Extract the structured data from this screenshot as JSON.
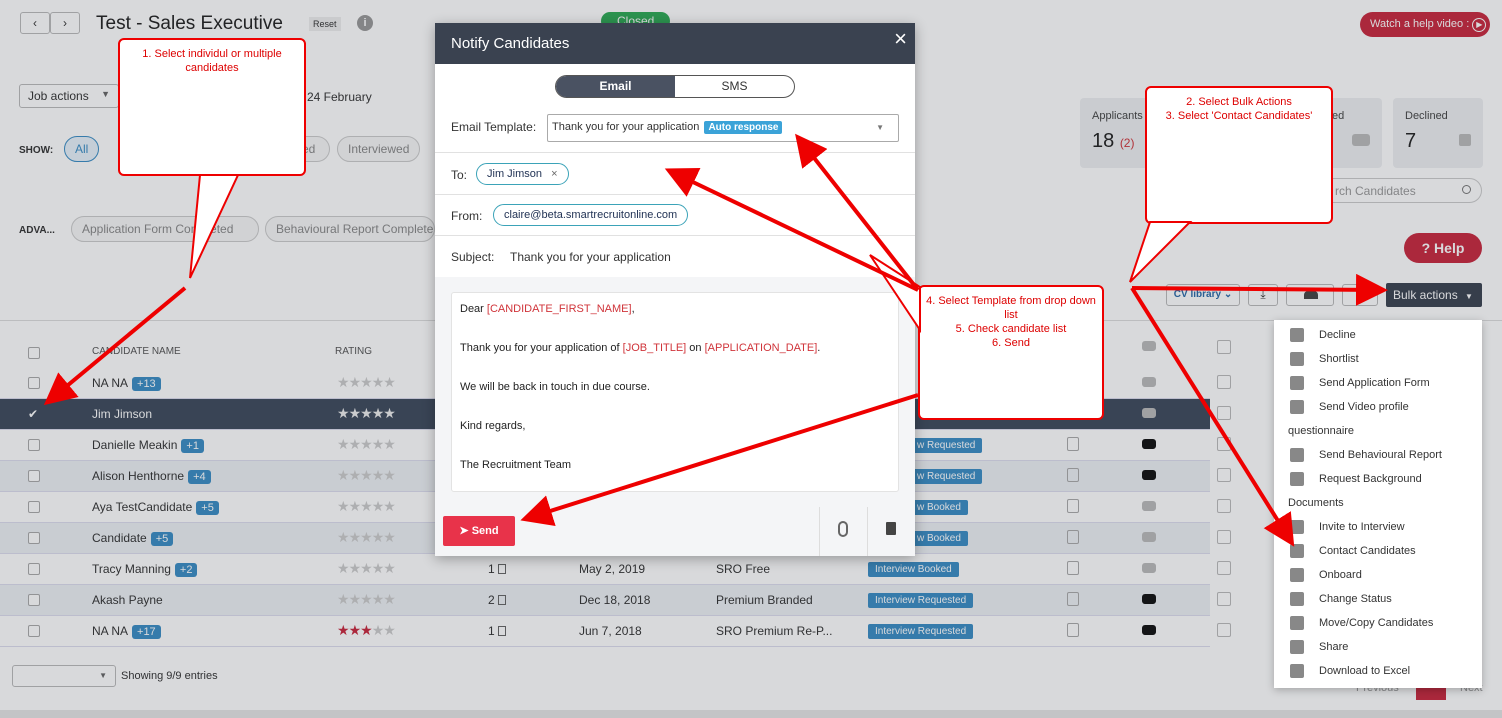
{
  "header": {
    "title": "Test - Sales Executive",
    "reset_label": "Reset",
    "status_label": "Closed",
    "help_video_label": "Watch a help video :",
    "job_actions_label": "Job actions",
    "date_text": "24 February"
  },
  "show": {
    "label": "SHOW:",
    "tabs": [
      "All",
      "ed",
      "Interviewed"
    ]
  },
  "advanced": {
    "label": "ADVA...",
    "filters": [
      "Application Form Completed",
      "Behavioural Report Complete"
    ]
  },
  "stats": [
    {
      "label": "Applicants",
      "value": "18",
      "extra": "(2)"
    },
    {
      "label": "ewed",
      "value": ""
    },
    {
      "label": "Declined",
      "value": "7"
    }
  ],
  "search": {
    "placeholder": "rch Candidates"
  },
  "help_button_label": "Help",
  "bulk_actions_label": "Bulk actions",
  "table": {
    "headers": {
      "name": "CANDIDATE NAME",
      "rating": "RATING"
    },
    "rows": [
      {
        "name": "NA NA",
        "badge": "+13",
        "stars": 0,
        "count": "",
        "date": "",
        "package": "",
        "status": "",
        "doc": false,
        "yt": "g"
      },
      {
        "name": "Jim Jimson",
        "badge": "",
        "stars": 5,
        "count": "",
        "date": "",
        "package": "",
        "status": "",
        "doc": false,
        "yt": "g",
        "selected": true
      },
      {
        "name": "Danielle Meakin",
        "badge": "+1",
        "stars": 0,
        "count": "",
        "date": "",
        "package": "",
        "status": "w Requested",
        "doc": true,
        "yt": "b"
      },
      {
        "name": "Alison Henthorne",
        "badge": "+4",
        "stars": 0,
        "count": "",
        "date": "",
        "package": "",
        "status": "w Requested",
        "doc": true,
        "yt": "b"
      },
      {
        "name": "Aya TestCandidate",
        "badge": "+5",
        "stars": 0,
        "count": "",
        "date": "",
        "package": "",
        "status": "w Booked",
        "doc": true,
        "yt": "g"
      },
      {
        "name": "Candidate",
        "badge": "+5",
        "stars": 0,
        "count": "",
        "date": "",
        "package": "",
        "status": "w Booked",
        "doc": true,
        "yt": "g"
      },
      {
        "name": "Tracy Manning",
        "badge": "+2",
        "stars": 0,
        "count": "1",
        "date": "May 2, 2019",
        "package": "SRO Free",
        "status": "Interview Booked",
        "doc": true,
        "yt": "g"
      },
      {
        "name": "Akash Payne",
        "badge": "",
        "stars": 0,
        "count": "2",
        "date": "Dec 18, 2018",
        "package": "Premium Branded",
        "status": "Interview Requested",
        "doc": true,
        "yt": "b"
      },
      {
        "name": "NA NA",
        "badge": "+17",
        "stars": 3,
        "count": "1",
        "date": "Jun 7, 2018",
        "package": "SRO Premium Re-P...",
        "status": "Interview Requested",
        "doc": true,
        "yt": "b"
      }
    ]
  },
  "footer": {
    "showing": "Showing 9/9 entries",
    "previous": "Previous",
    "next": "Next",
    "page": "1"
  },
  "modal": {
    "title": "Notify Candidates",
    "tabs": [
      "Email",
      "SMS"
    ],
    "template_label": "Email Template:",
    "template_value": "Thank you for your application",
    "template_badge": "Auto response",
    "to_label": "To:",
    "to_chip": "Jim Jimson",
    "from_label": "From:",
    "from_chip": "claire@beta.smartrecruitonline.com",
    "subject_label": "Subject:",
    "subject_value": "Thank you for your application",
    "body": {
      "l1a": "Dear ",
      "l1ph": "[CANDIDATE_FIRST_NAME]",
      "l1b": ",",
      "l2a": "Thank you for your application of ",
      "l2ph1": "[JOB_TITLE]",
      "l2b": " on ",
      "l2ph2": "[APPLICATION_DATE]",
      "l2c": ".",
      "l3": "We will be back in touch in due course.",
      "l4": "Kind regards,",
      "l5": "The Recruitment Team"
    },
    "send_label": "Send"
  },
  "bulk_menu": [
    {
      "label": "Decline",
      "icon": true
    },
    {
      "label": "Shortlist",
      "icon": true
    },
    {
      "label": "Send Application Form",
      "icon": true
    },
    {
      "label": "Send Video profile",
      "icon": true
    },
    {
      "label": "questionnaire",
      "icon": false
    },
    {
      "label": "Send Behavioural Report",
      "icon": true
    },
    {
      "label": "Request Background",
      "icon": true
    },
    {
      "label": "Documents",
      "icon": false
    },
    {
      "label": "Invite to Interview",
      "icon": true
    },
    {
      "label": "Contact Candidates",
      "icon": true
    },
    {
      "label": "Onboard",
      "icon": true
    },
    {
      "label": "Change Status",
      "icon": true
    },
    {
      "label": "Move/Copy Candidates",
      "icon": true
    },
    {
      "label": "Share",
      "icon": true
    },
    {
      "label": "Download to Excel",
      "icon": true
    }
  ],
  "callouts": {
    "c1": "1. Select individul or multiple candidates",
    "c2a": "2. Select Bulk Actions",
    "c2b": "3. Select 'Contact Candidates'",
    "c4a": "4. Select Template from drop down list",
    "c4b": "5. Check candidate list",
    "c4c": "6. Send"
  },
  "colors": {
    "accent": "#e8334a",
    "dark": "#3a4250",
    "blue": "#3a8dc5",
    "callout_red": "#e00000"
  }
}
